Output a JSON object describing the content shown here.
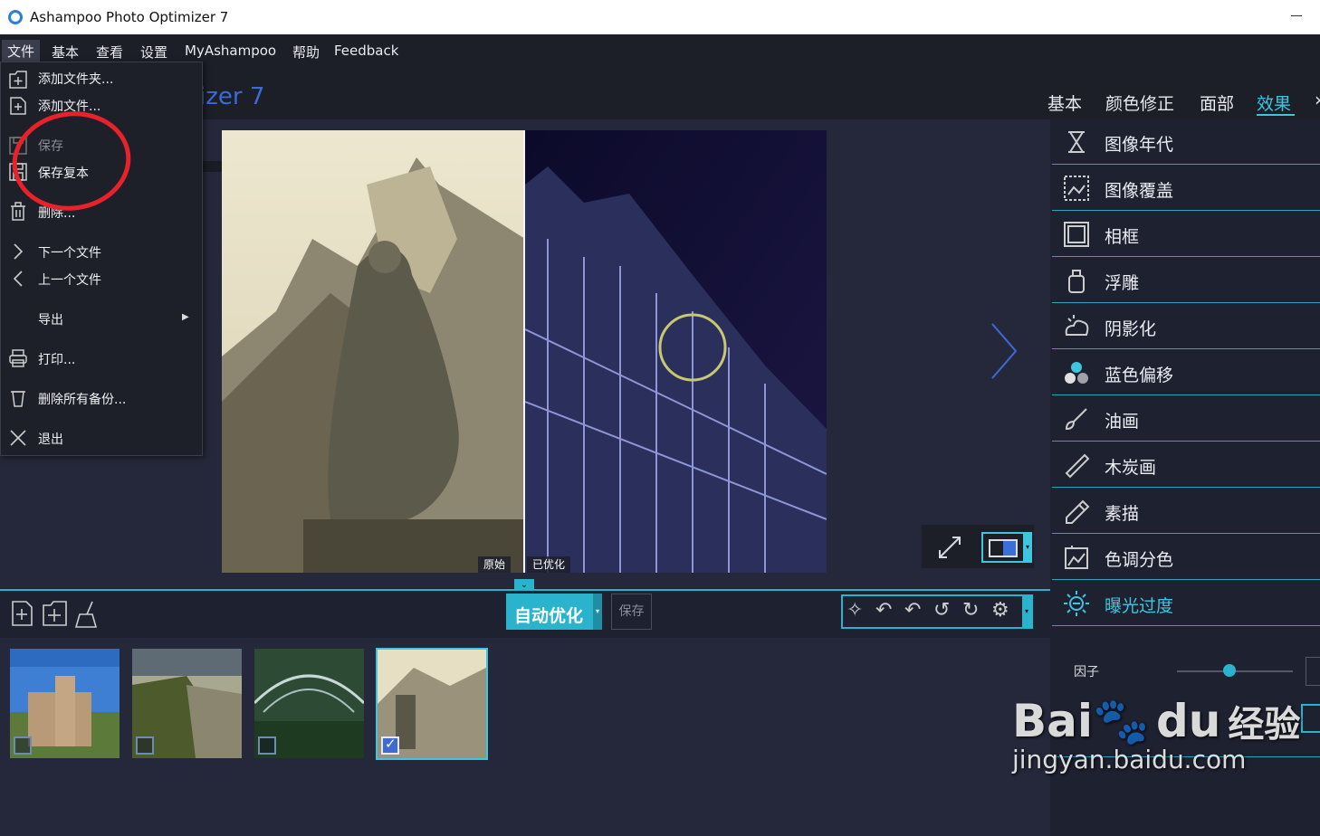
{
  "window": {
    "title": "Ashampoo Photo Optimizer 7"
  },
  "menubar": [
    "文件",
    "基本",
    "查看",
    "设置",
    "MyAshampoo",
    "帮助",
    "Feedback"
  ],
  "app_header": "izer 7",
  "top_tabs": [
    "基本",
    "颜色修正",
    "面部",
    "效果"
  ],
  "file_menu": {
    "add_folder": "添加文件夹...",
    "add_file": "添加文件...",
    "save": "保存",
    "save_copy": "保存复本",
    "delete": "删除...",
    "next_file": "下一个文件",
    "prev_file": "上一个文件",
    "export": "导出",
    "print": "打印...",
    "delete_backups": "删除所有备份...",
    "exit": "退出"
  },
  "preview": {
    "original_label": "原始",
    "optimized_label": "已优化"
  },
  "toolbar": {
    "auto_optimize": "自动优化",
    "save": "保存"
  },
  "effects": [
    {
      "label": "图像年代",
      "icon": "hourglass-icon"
    },
    {
      "label": "图像覆盖",
      "icon": "image-overlay-icon"
    },
    {
      "label": "相框",
      "icon": "frame-icon"
    },
    {
      "label": "浮雕",
      "icon": "emboss-icon"
    },
    {
      "label": "阴影化",
      "icon": "cloud-shadow-icon"
    },
    {
      "label": "蓝色偏移",
      "icon": "blue-shift-icon"
    },
    {
      "label": "油画",
      "icon": "paint-brush-icon"
    },
    {
      "label": "木炭画",
      "icon": "charcoal-icon"
    },
    {
      "label": "素描",
      "icon": "pencil-icon"
    },
    {
      "label": "色调分色",
      "icon": "posterize-icon"
    },
    {
      "label": "曝光过度",
      "icon": "sun-icon"
    }
  ],
  "factor": {
    "label": "因子",
    "value": 0.45
  },
  "thumbnails": [
    {
      "checked": false
    },
    {
      "checked": false
    },
    {
      "checked": false
    },
    {
      "checked": true
    }
  ],
  "watermark": {
    "brand": "Bai",
    "brand2": "du",
    "cn": "经验",
    "url": "jingyan.baidu.com"
  },
  "colors": {
    "accent": "#3ec6e0",
    "annotation": "#e8222a",
    "background": "#1c1e28"
  }
}
